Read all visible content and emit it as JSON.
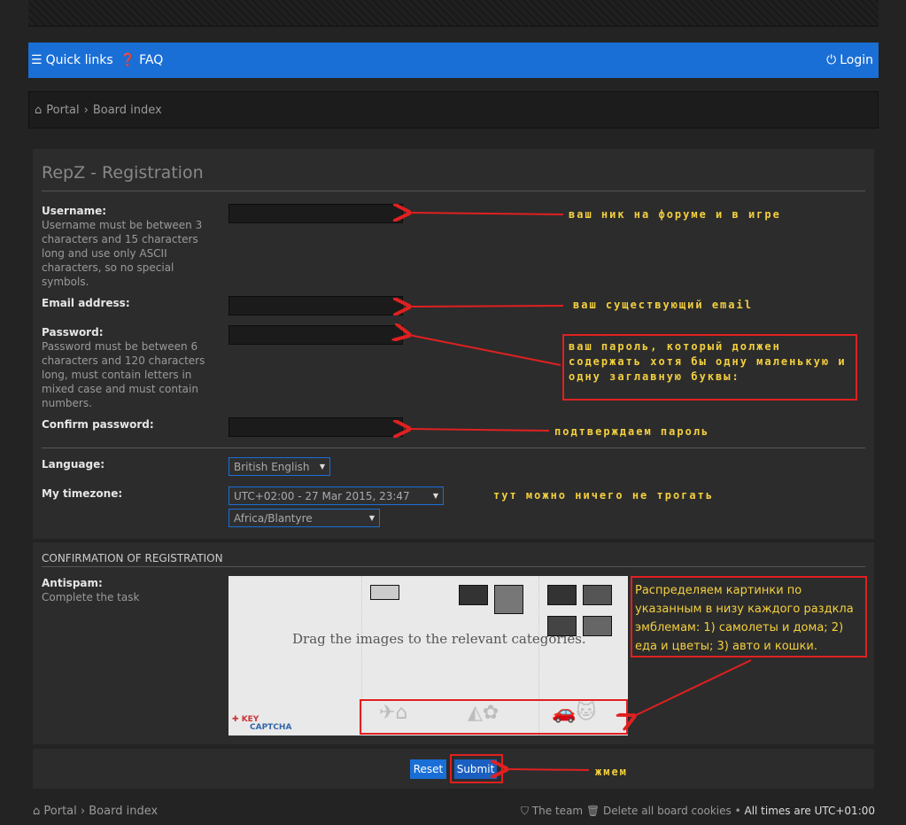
{
  "navbar": {
    "quick_links": "Quick links",
    "faq": "FAQ",
    "login": "Login"
  },
  "breadcrumb": {
    "portal": "Portal",
    "board_index": "Board index"
  },
  "registration": {
    "title": "RepZ - Registration",
    "username_label": "Username:",
    "username_hint": "Username must be between 3 characters and 15 characters long and use only ASCII characters, so no special symbols.",
    "email_label": "Email address:",
    "password_label": "Password:",
    "password_hint": "Password must be between 6 characters and 120 characters long, must contain letters in mixed case and must contain numbers.",
    "confirm_label": "Confirm password:",
    "language_label": "Language:",
    "language_value": "British English",
    "timezone_label": "My timezone:",
    "timezone_value": "UTC+02:00 - 27 Mar 2015, 23:47",
    "timezone_region": "Africa/Blantyre"
  },
  "confirmation": {
    "heading": "CONFIRMATION OF REGISTRATION",
    "antispam_label": "Antispam:",
    "antispam_hint": "Complete the task",
    "captcha_message": "Drag the images to the relevant categories.",
    "captcha_brand_1": "KEY",
    "captcha_brand_2": "CAPTCHA"
  },
  "buttons": {
    "reset": "Reset",
    "submit": "Submit"
  },
  "annotations": {
    "nick": "ваш ник на форуме и в игре",
    "email": "ваш существующий email",
    "password": "ваш пароль, который должен содержать хотя бы одну маленькую и одну заглавную буквы:",
    "confirm": "подтверждаем пароль",
    "timezone": "тут можно ничего не трогать",
    "captcha": "Распределяем картинки по указанным в низу каждого раздкла эмблемам: 1) самолеты и дома; 2) еда и цветы; 3) авто и кошки.",
    "submit": "жмем"
  },
  "footer": {
    "portal": "Portal",
    "board_index": "Board index",
    "team": "The team",
    "delete_cookies": "Delete all board cookies",
    "times": "All times are UTC+01:00"
  },
  "colors": {
    "accent": "#1a6fd6",
    "annotation": "#f4d03f",
    "arrow": "#e02020"
  }
}
